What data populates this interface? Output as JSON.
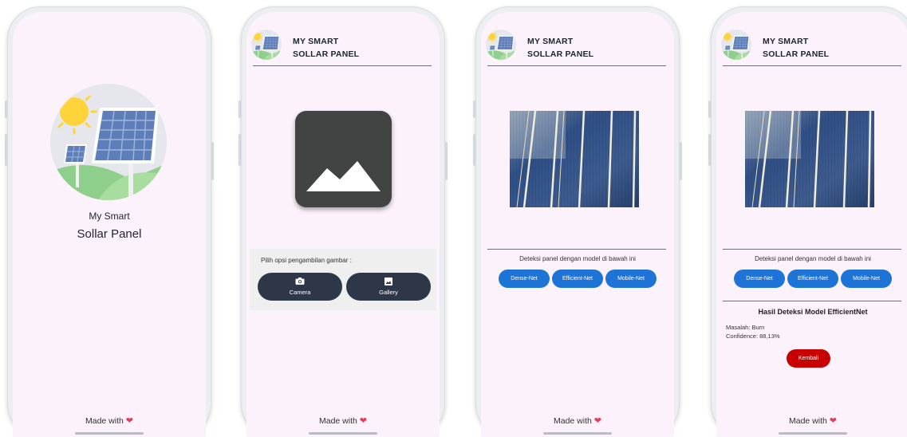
{
  "footer": {
    "made_with": "Made with",
    "heart": "❤"
  },
  "splash": {
    "title_line1": "My Smart",
    "title_line2": "Sollar Panel"
  },
  "header": {
    "title_line1": "MY SMART",
    "title_line2": "SOLLAR PANEL"
  },
  "picker": {
    "prompt": "Pilih opsi pengambilan gambar :",
    "camera_label": "Camera",
    "gallery_label": "Gallery"
  },
  "detection": {
    "prompt": "Deteksi panel dengan model di bawah ini",
    "models": [
      "Dense-Net",
      "Efficient-Net",
      "Mobile-Net"
    ]
  },
  "result": {
    "title": "Hasil Deteksi Model EfficientNet",
    "problem": "Masalah: Burn",
    "confidence": "Confidence: 88,13%",
    "back_label": "Kembali"
  },
  "colors": {
    "screen_bg": "#fcf2fb",
    "dark_button": "#2e3748",
    "model_button": "#1e73d6",
    "back_button": "#c90000",
    "heart": "#e23d5b"
  }
}
